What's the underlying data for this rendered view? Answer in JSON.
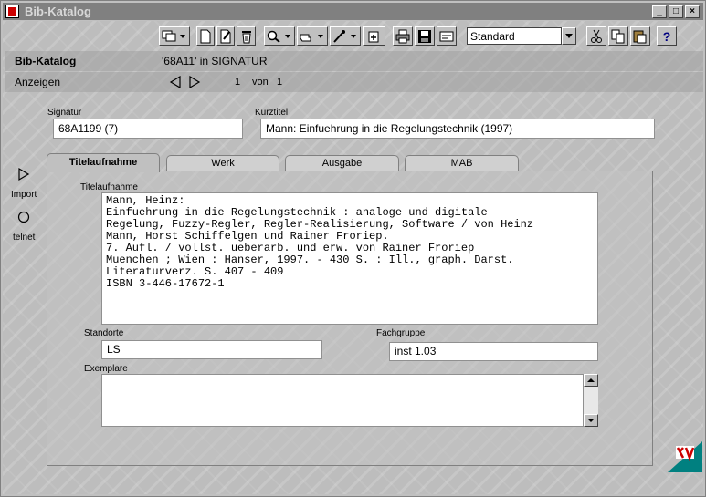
{
  "window": {
    "title": "Bib-Katalog"
  },
  "toolbar": {
    "view_select": "Standard",
    "icons": [
      "copy-window-icon",
      "new-document-icon",
      "edit-document-icon",
      "delete-icon",
      "search-icon",
      "hand-pointer-icon",
      "pen-icon",
      "import-add-icon",
      "print-icon",
      "save-icon",
      "form-icon",
      "cut-icon",
      "copy-icon",
      "paste-icon",
      "help-icon"
    ],
    "help_label": "?"
  },
  "header": {
    "app_label": "Bib-Katalog",
    "query": "'68A11' in SIGNATUR",
    "mode_label": "Anzeigen",
    "record_current": "1",
    "record_of_label": "von",
    "record_total": "1"
  },
  "fields": {
    "signatur_label": "Signatur",
    "signatur_value": "68A1199 (7)",
    "kurztitel_label": "Kurztitel",
    "kurztitel_value": "Mann: Einfuehrung in die Regelungstechnik (1997)"
  },
  "side_actions": {
    "import_label": "Import",
    "telnet_label": "telnet"
  },
  "tabs": [
    {
      "label": "Titelaufnahme",
      "active": true
    },
    {
      "label": "Werk",
      "active": false
    },
    {
      "label": "Ausgabe",
      "active": false
    },
    {
      "label": "MAB",
      "active": false
    }
  ],
  "titelaufnahme": {
    "label": "Titelaufnahme",
    "lines": [
      "Mann, Heinz:",
      "Einfuehrung in die Regelungstechnik : analoge und digitale",
      "Regelung, Fuzzy-Regler, Regler-Realisierung, Software / von Heinz",
      "Mann, Horst Schiffelgen und Rainer Froriep.",
      "7. Aufl. / vollst. ueberarb. und erw. von Rainer Froriep",
      "Muenchen ; Wien : Hanser, 1997. - 430 S. : Ill., graph. Darst.",
      "Literaturverz. S. 407 - 409",
      "ISBN 3-446-17672-1"
    ],
    "standorte_label": "Standorte",
    "standorte_value": "LS",
    "fachgruppe_label": "Fachgruppe",
    "fachgruppe_value": "inst 1.03",
    "exemplare_label": "Exemplare",
    "exemplare_value": ""
  },
  "colors": {
    "titlebar": "#808080",
    "window_bg": "#c0c0c0",
    "logo_red": "#cc0000",
    "logo_teal": "#008080"
  }
}
